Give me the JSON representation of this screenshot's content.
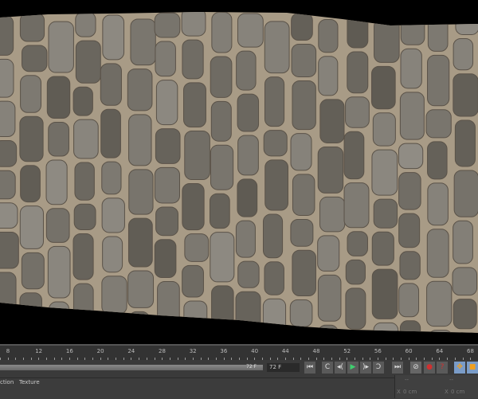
{
  "timeline": {
    "ruler_labels": [
      "8",
      "12",
      "16",
      "20",
      "24",
      "28",
      "32",
      "36",
      "40",
      "44",
      "48",
      "52",
      "56",
      "60",
      "64",
      "68"
    ],
    "end_frame": "72 F",
    "current_frame": "72 F"
  },
  "transport": {
    "first": "⏮",
    "prev_key": "C",
    "prev_frame": "◂(",
    "play": "▶",
    "next_frame": ")▸",
    "next_key": "Ɔ",
    "last": "⏭"
  },
  "menu": {
    "items": [
      "ction",
      "Texture"
    ]
  },
  "coords": {
    "header_a": "--",
    "header_b": "--",
    "x_label": "X",
    "x_value": "0 cm",
    "x2_label": "X",
    "x2_value": "0 cm"
  },
  "colors": {
    "play": "#3fcf6f",
    "record": "#d03030",
    "accent": "#f0a020"
  }
}
